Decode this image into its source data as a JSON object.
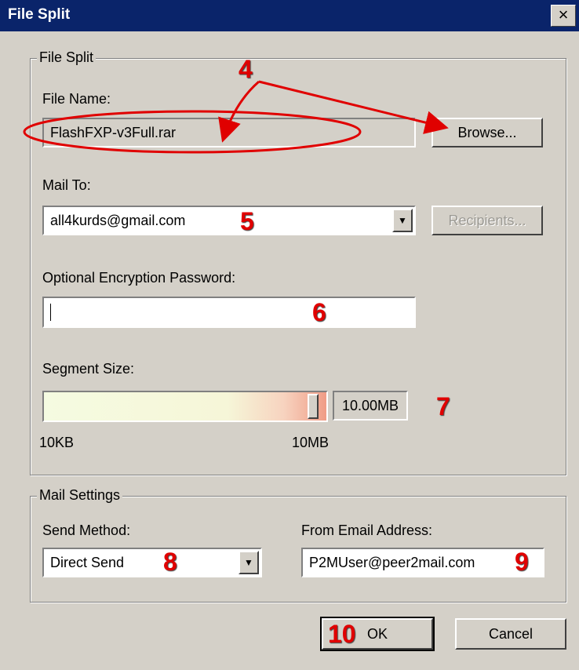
{
  "window": {
    "title": "File Split",
    "close_glyph": "×"
  },
  "file_group": {
    "legend": "File Split",
    "file_name_label": "File Name:",
    "file_name_value": "FlashFXP-v3Full.rar",
    "browse_label": "Browse...",
    "mail_to_label": "Mail To:",
    "mail_to_value": "all4kurds@gmail.com",
    "recipients_label": "Recipients...",
    "password_label": "Optional Encryption Password:",
    "password_value": "",
    "segment_label": "Segment Size:",
    "segment_value": "10.00MB",
    "segment_min_label": "10KB",
    "segment_max_label": "10MB"
  },
  "mail_group": {
    "legend": "Mail Settings",
    "send_method_label": "Send Method:",
    "send_method_value": "Direct Send",
    "from_label": "From Email Address:",
    "from_value": "P2MUser@peer2mail.com"
  },
  "buttons": {
    "ok_label": "OK",
    "cancel_label": "Cancel"
  },
  "annotations": {
    "n4": "4",
    "n5": "5",
    "n6": "6",
    "n7": "7",
    "n8": "8",
    "n9": "9",
    "n10": "10",
    "color": "#e00000"
  },
  "icons": {
    "dropdown": "chevron-down-icon",
    "close": "close-icon"
  }
}
